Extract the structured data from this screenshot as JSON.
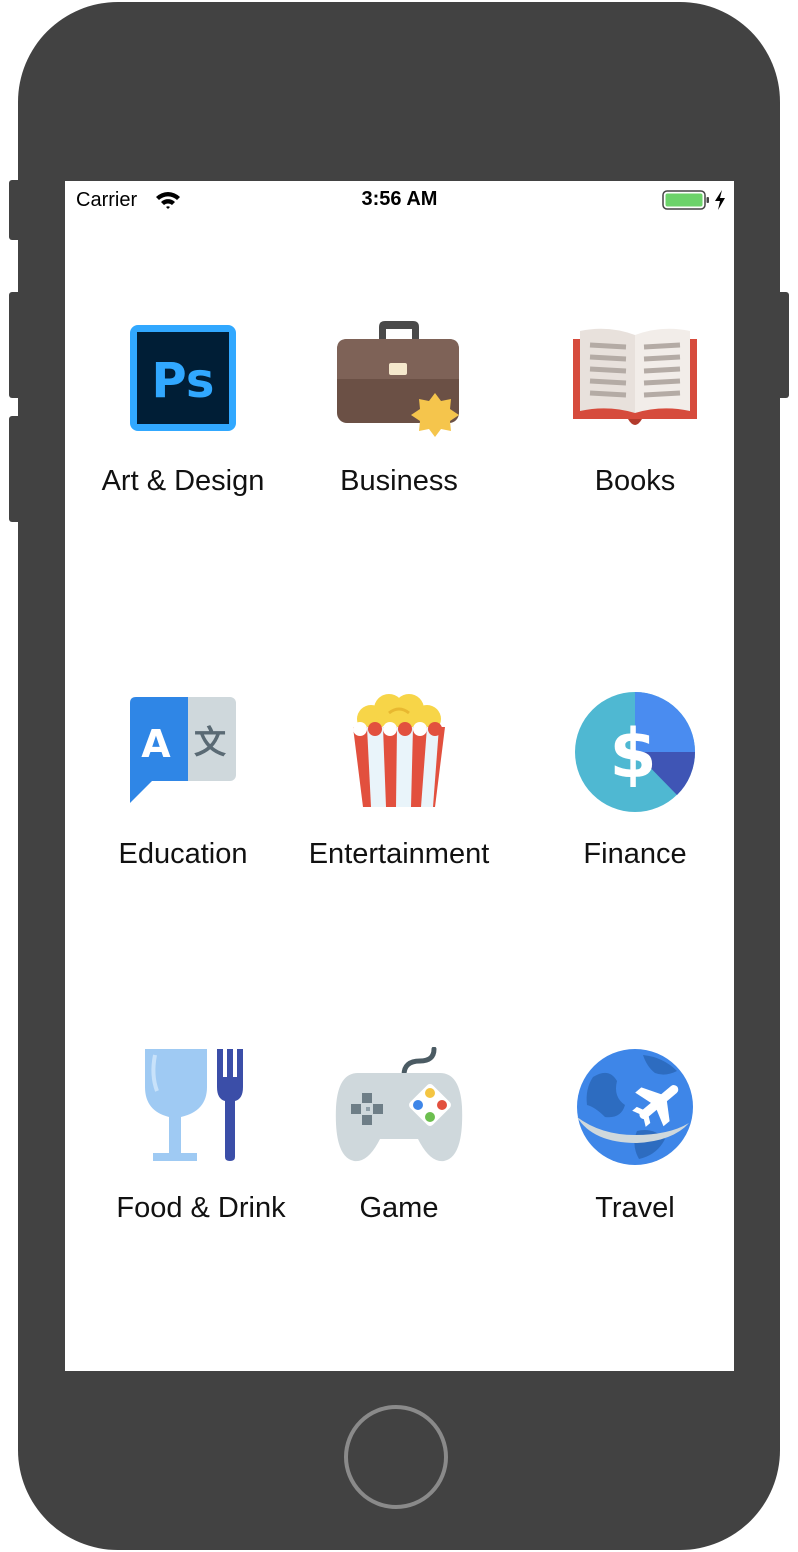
{
  "status_bar": {
    "carrier": "Carrier",
    "time": "3:56 AM",
    "battery_color": "#6cd36a"
  },
  "categories": [
    {
      "label": "Art & Design",
      "icon": "photoshop-icon"
    },
    {
      "label": "Business",
      "icon": "briefcase-icon"
    },
    {
      "label": "Books",
      "icon": "open-book-icon"
    },
    {
      "label": "Education",
      "icon": "translate-icon"
    },
    {
      "label": "Entertainment",
      "icon": "popcorn-icon"
    },
    {
      "label": "Finance",
      "icon": "finance-dollar-icon"
    },
    {
      "label": "Food & Drink",
      "icon": "glass-fork-icon"
    },
    {
      "label": "Game",
      "icon": "gamepad-icon"
    },
    {
      "label": "Travel",
      "icon": "globe-plane-icon"
    }
  ],
  "device": {
    "bezel_color": "#424242",
    "home_button_ring_color": "#8a8a8a"
  }
}
